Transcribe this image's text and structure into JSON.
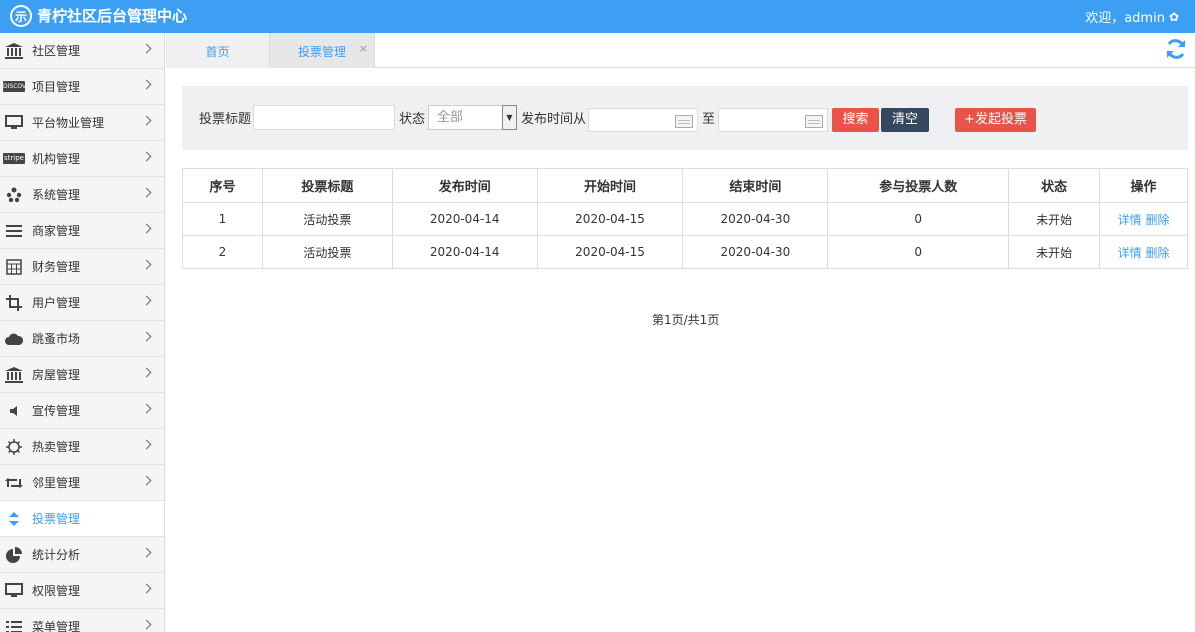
{
  "app": {
    "title": "青柠社区后台管理中心",
    "logo_glyph": "示",
    "welcome": "欢迎，admin",
    "gear_icon": "gear-icon"
  },
  "colors": {
    "brand": "#3c9ff3",
    "danger": "#e9534a",
    "dark": "#34495e"
  },
  "sidebar": {
    "items": [
      {
        "label": "社区管理",
        "icon": "bank-icon"
      },
      {
        "label": "项目管理",
        "icon": "discover-card-icon",
        "badge": "DISCOVER"
      },
      {
        "label": "平台物业管理",
        "icon": "monitor-icon"
      },
      {
        "label": "机构管理",
        "icon": "stripe-icon",
        "badge": "stripe"
      },
      {
        "label": "系统管理",
        "icon": "yelp-icon"
      },
      {
        "label": "商家管理",
        "icon": "menu-lines-icon"
      },
      {
        "label": "财务管理",
        "icon": "calculator-icon"
      },
      {
        "label": "用户管理",
        "icon": "crop-icon"
      },
      {
        "label": "跳蚤市场",
        "icon": "cloud-icon"
      },
      {
        "label": "房屋管理",
        "icon": "bank-icon"
      },
      {
        "label": "宣传管理",
        "icon": "volume-icon"
      },
      {
        "label": "热卖管理",
        "icon": "gear-outline-icon"
      },
      {
        "label": "邻里管理",
        "icon": "retweet-icon"
      },
      {
        "label": "投票管理",
        "icon": "sort-icon",
        "active": true
      },
      {
        "label": "统计分析",
        "icon": "pie-chart-icon"
      },
      {
        "label": "权限管理",
        "icon": "desktop-icon"
      },
      {
        "label": "菜单管理",
        "icon": "list-icon"
      }
    ]
  },
  "tabs": [
    {
      "label": "首页"
    },
    {
      "label": "投票管理",
      "close": "×"
    }
  ],
  "filter": {
    "title_label": "投票标题",
    "title_value": "",
    "status_label": "状态",
    "status_selected": "全部",
    "time_label": "发布时间从",
    "to_label": "至",
    "search_btn": "搜索",
    "clear_btn": "清空",
    "start_btn": "+发起投票"
  },
  "table": {
    "headers": [
      "序号",
      "投票标题",
      "发布时间",
      "开始时间",
      "结束时间",
      "参与投票人数",
      "状态",
      "操作"
    ],
    "rows": [
      {
        "no": "1",
        "title": "活动投票",
        "publish": "2020-04-14",
        "start": "2020-04-15",
        "end": "2020-04-30",
        "count": "0",
        "status": "未开始",
        "detail": "详情",
        "delete": "删除"
      },
      {
        "no": "2",
        "title": "活动投票",
        "publish": "2020-04-14",
        "start": "2020-04-15",
        "end": "2020-04-30",
        "count": "0",
        "status": "未开始",
        "detail": "详情",
        "delete": "删除"
      }
    ]
  },
  "pager": {
    "text": "第1页/共1页"
  }
}
